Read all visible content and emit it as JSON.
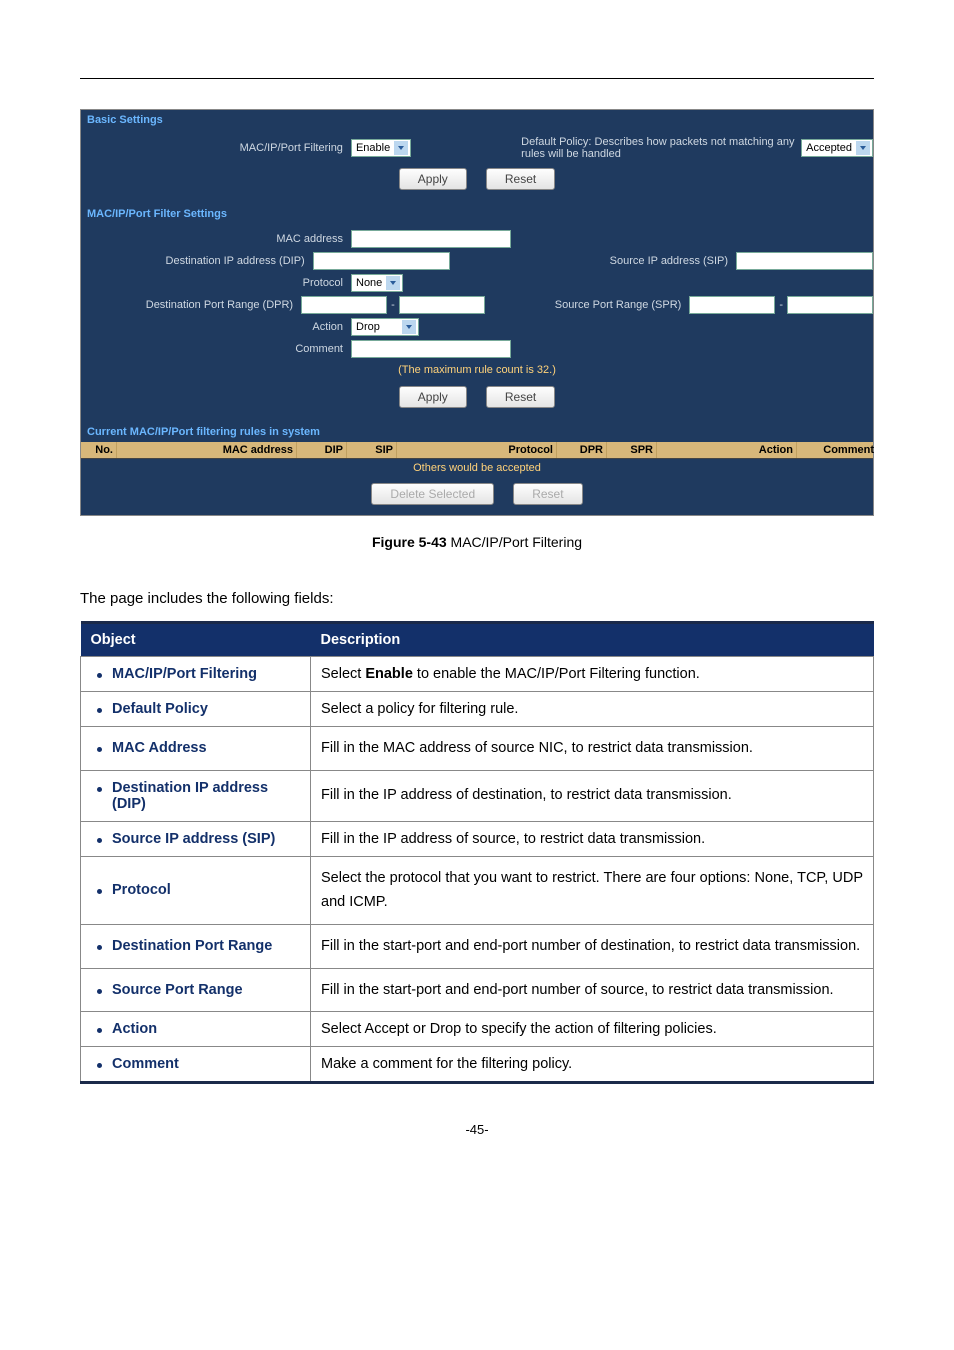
{
  "screenshot": {
    "basic": {
      "title": "Basic Settings",
      "filtering_label": "MAC/IP/Port Filtering",
      "filtering_value": "Enable",
      "policy_label": "Default Policy: Describes how packets not matching any rules will be handled",
      "policy_value": "Accepted",
      "apply": "Apply",
      "reset": "Reset"
    },
    "filter": {
      "title": "MAC/IP/Port Filter Settings",
      "mac_label": "MAC address",
      "dip_label": "Destination IP address (DIP)",
      "sip_label": "Source IP address (SIP)",
      "protocol_label": "Protocol",
      "protocol_value": "None",
      "dpr_label": "Destination Port Range (DPR)",
      "spr_label": "Source Port Range (SPR)",
      "action_label": "Action",
      "action_value": "Drop",
      "comment_label": "Comment",
      "note": "(The maximum rule count is 32.)",
      "apply": "Apply",
      "reset": "Reset"
    },
    "current": {
      "title": "Current MAC/IP/Port filtering rules in system",
      "headers": [
        "No.",
        "MAC address",
        "DIP",
        "SIP",
        "Protocol",
        "DPR",
        "SPR",
        "Action",
        "Comment"
      ],
      "others": "Others would be accepted",
      "delete": "Delete Selected",
      "reset": "Reset"
    }
  },
  "caption": {
    "fig": "Figure 5-43",
    "text": " MAC/IP/Port Filtering"
  },
  "intro": "The page includes the following fields:",
  "table": {
    "head_obj": "Object",
    "head_desc": "Description",
    "rows": [
      {
        "obj": "MAC/IP/Port Filtering",
        "desc_pre": "Select ",
        "desc_bold": "Enable",
        "desc_post": " to enable the MAC/IP/Port Filtering function."
      },
      {
        "obj": "Default Policy",
        "desc": "Select a policy for filtering rule."
      },
      {
        "obj": "MAC Address",
        "desc": "Fill in the MAC address of source NIC, to restrict data transmission."
      },
      {
        "obj": "Destination IP address (DIP)",
        "desc": "Fill in the IP address of destination, to restrict data transmission."
      },
      {
        "obj": "Source IP address (SIP)",
        "desc": "Fill in the IP address of source, to restrict data transmission."
      },
      {
        "obj": "Protocol",
        "desc": "Select the protocol that you want to restrict. There are four options: None, TCP, UDP and ICMP."
      },
      {
        "obj": "Destination Port Range",
        "desc": "Fill in the start-port and end-port number of destination, to restrict data transmission."
      },
      {
        "obj": "Source Port Range",
        "desc": "Fill in the start-port and end-port number of source, to restrict data transmission."
      },
      {
        "obj": "Action",
        "desc": "Select Accept or Drop to specify the action of filtering policies."
      },
      {
        "obj": "Comment",
        "desc": "Make a comment for the filtering policy."
      }
    ]
  },
  "footer": "-45-"
}
